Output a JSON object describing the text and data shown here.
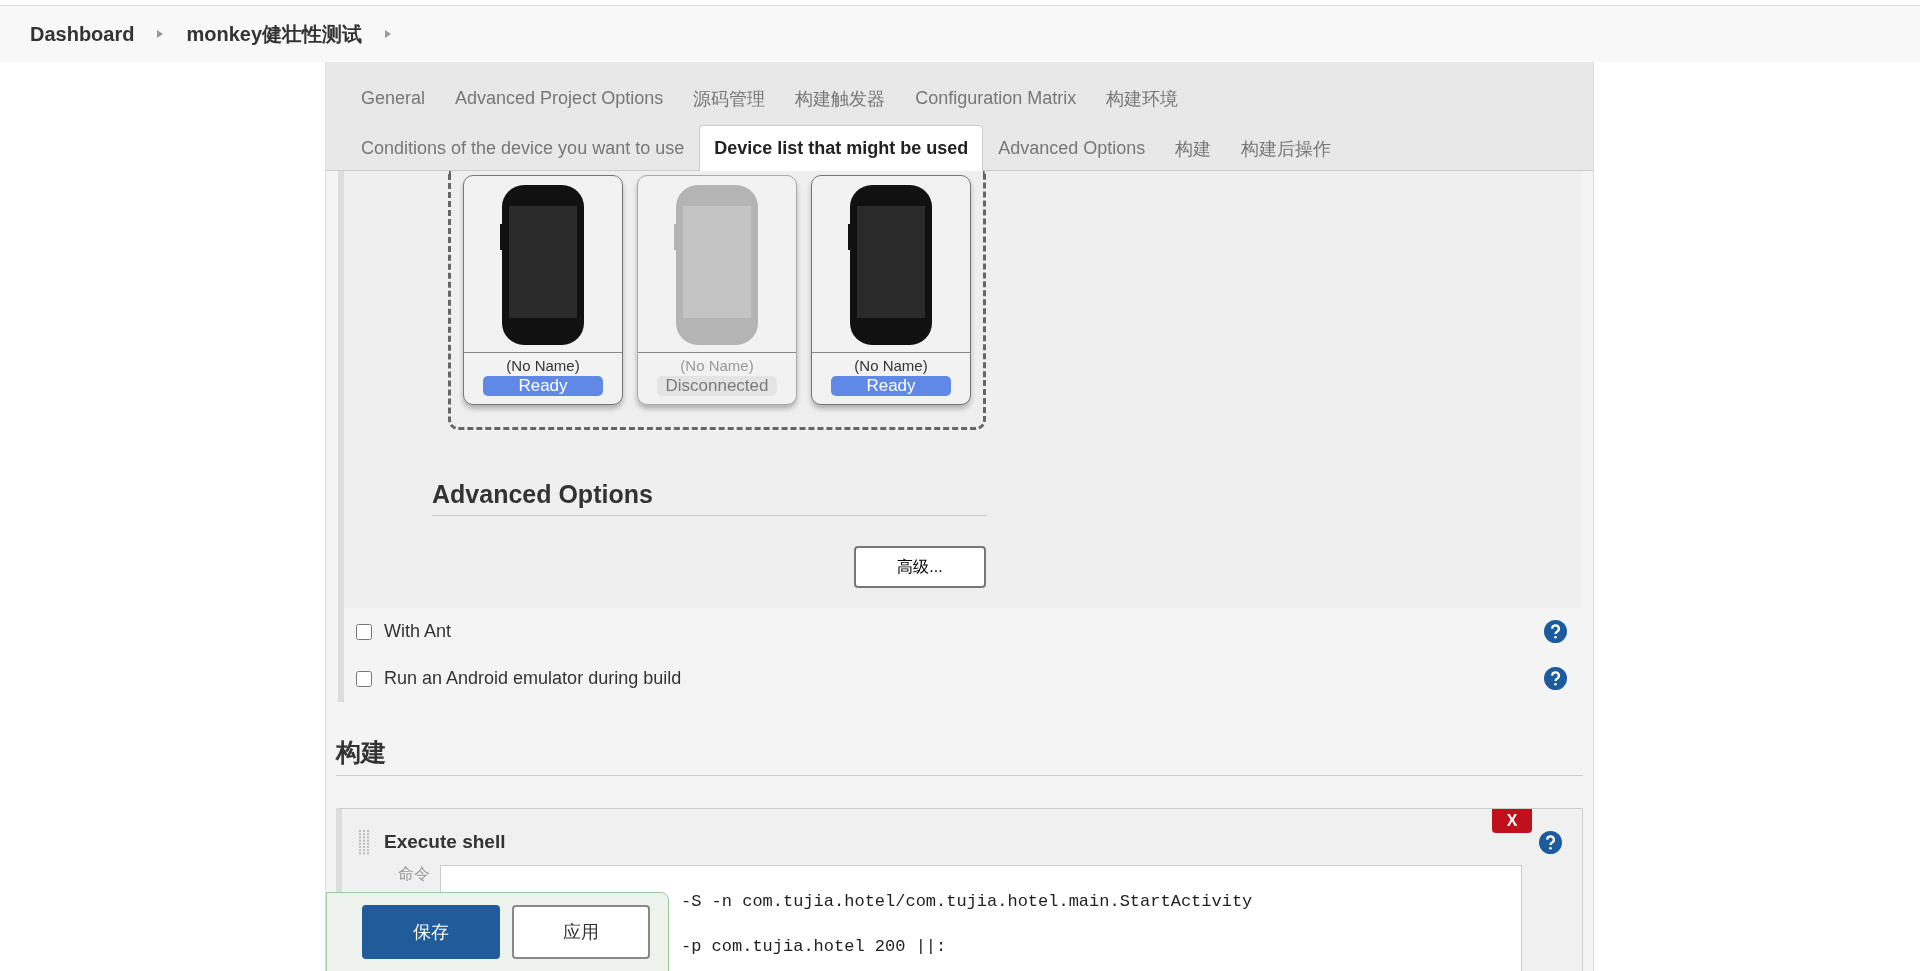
{
  "breadcrumbs": [
    {
      "label": "Dashboard"
    },
    {
      "label": "monkey健壮性测试"
    }
  ],
  "tabs": [
    [
      {
        "label": "General",
        "selected": false
      },
      {
        "label": "Advanced Project Options",
        "selected": false
      },
      {
        "label": "源码管理",
        "selected": false
      },
      {
        "label": "构建触发器",
        "selected": false
      },
      {
        "label": "Configuration Matrix",
        "selected": false
      },
      {
        "label": "构建环境",
        "selected": false
      }
    ],
    [
      {
        "label": "Conditions of the device you want to use",
        "selected": false
      },
      {
        "label": "Device list that might be used",
        "selected": true
      },
      {
        "label": "Advanced Options",
        "selected": false
      },
      {
        "label": "构建",
        "selected": false
      },
      {
        "label": "构建后操作",
        "selected": false
      }
    ]
  ],
  "devices": [
    {
      "name": "(No Name)",
      "status": "Ready",
      "connected": true
    },
    {
      "name": "(No Name)",
      "status": "Disconnected",
      "connected": false
    },
    {
      "name": "(No Name)",
      "status": "Ready",
      "connected": true
    }
  ],
  "advanced_options": {
    "heading": "Advanced Options",
    "button": "高级..."
  },
  "options": [
    {
      "label": "With Ant",
      "checked": false
    },
    {
      "label": "Run an Android emulator during build",
      "checked": false
    }
  ],
  "build_section": {
    "heading": "构建",
    "step": {
      "title": "Execute shell",
      "delete": "X",
      "command_label": "命令",
      "lines": [
        "-S -n com.tujia.hotel/com.tujia.hotel.main.StartActivity",
        "-p com.tujia.hotel 200 ||:"
      ]
    }
  },
  "save_bar": {
    "save": "保存",
    "apply": "应用"
  }
}
